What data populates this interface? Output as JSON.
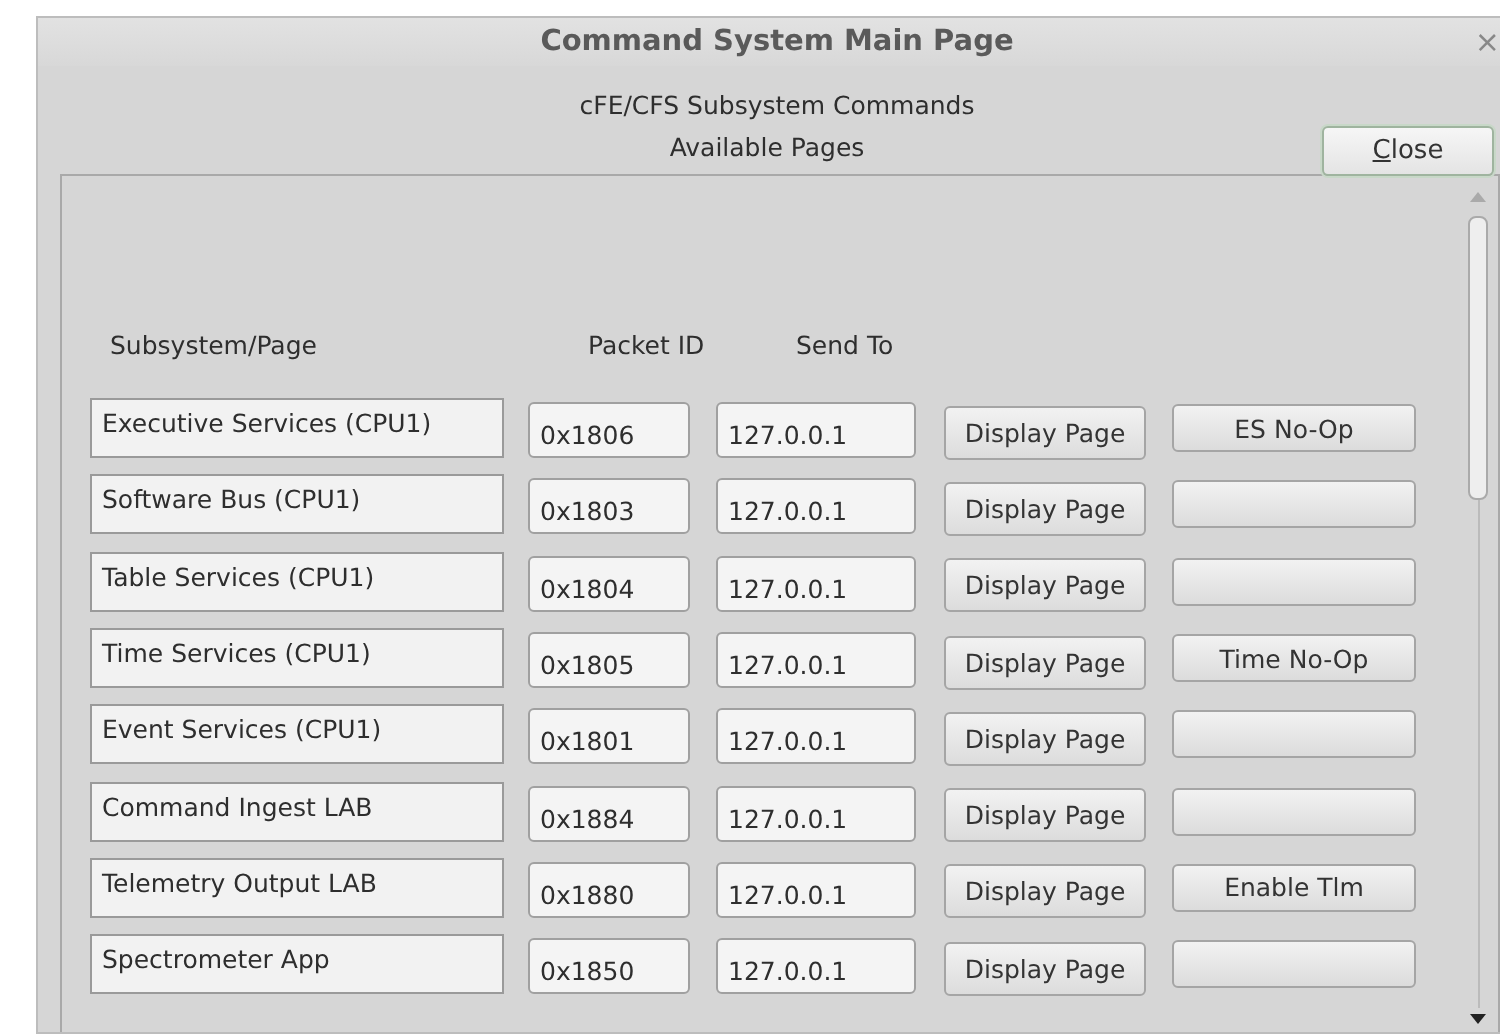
{
  "window": {
    "title": "Command System Main Page",
    "close_glyph": "×"
  },
  "heading": "cFE/CFS Subsystem Commands",
  "subheading": "Available Pages",
  "close_button": "Close",
  "columns": [
    "Subsystem/Page",
    "Packet ID",
    "Send To"
  ],
  "rows": [
    {
      "name": "Executive Services (CPU1)",
      "packet_id": "0x1806",
      "send_to": "127.0.0.1",
      "display": "Display Page",
      "command": "ES No-Op"
    },
    {
      "name": "Software Bus (CPU1)",
      "packet_id": "0x1803",
      "send_to": "127.0.0.1",
      "display": "Display Page"
    },
    {
      "name": "Table Services (CPU1)",
      "packet_id": "0x1804",
      "send_to": "127.0.0.1",
      "display": "Display Page"
    },
    {
      "name": "Time Services (CPU1)",
      "packet_id": "0x1805",
      "send_to": "127.0.0.1",
      "display": "Display Page",
      "command": "Time No-Op"
    },
    {
      "name": "Event Services (CPU1)",
      "packet_id": "0x1801",
      "send_to": "127.0.0.1",
      "display": "Display Page"
    },
    {
      "name": "Command Ingest LAB",
      "packet_id": "0x1884",
      "send_to": "127.0.0.1",
      "display": "Display Page"
    },
    {
      "name": "Telemetry Output LAB",
      "packet_id": "0x1880",
      "send_to": "127.0.0.1",
      "display": "Display Page",
      "command": "Enable Tlm"
    },
    {
      "name": "Spectrometer App",
      "packet_id": "0x1850",
      "send_to": "127.0.0.1",
      "display": "Display Page"
    }
  ]
}
